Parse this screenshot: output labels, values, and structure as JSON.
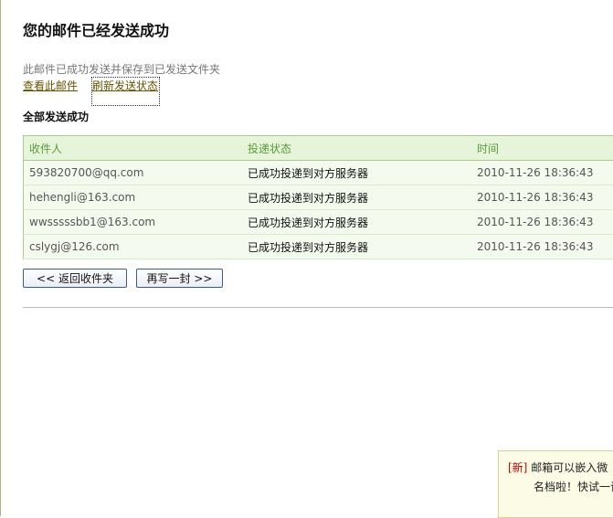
{
  "header": {
    "title": "您的邮件已经发送成功",
    "subtitle": "此邮件已成功发送并保存到已发送文件夹"
  },
  "links": {
    "view_mail": "查看此邮件",
    "refresh_status": "刷新发送状态"
  },
  "section_label": "全部发送成功",
  "table": {
    "columns": [
      "收件人",
      "投递状态",
      "时间"
    ],
    "rows": [
      {
        "recipient": "593820700@qq.com",
        "status": "已成功投递到对方服务器",
        "time": "2010-11-26 18:36:43"
      },
      {
        "recipient": "hehengli@163.com",
        "status": "已成功投递到对方服务器",
        "time": "2010-11-26 18:36:43"
      },
      {
        "recipient": "wwsssssbb1@163.com",
        "status": "已成功投递到对方服务器",
        "time": "2010-11-26 18:36:43"
      },
      {
        "recipient": "cslygj@126.com",
        "status": "已成功投递到对方服务器",
        "time": "2010-11-26 18:36:43"
      }
    ]
  },
  "buttons": {
    "back_to_inbox": "<< 返回收件夹",
    "compose_another": "再写一封 >>"
  },
  "promo": {
    "badge": "[新]",
    "line1": "邮箱可以嵌入微",
    "line2": "名档啦！快试一试"
  },
  "colors": {
    "table_header_bg": "#e6f5d9",
    "table_header_text": "#5a9a3a",
    "table_border": "#a9cc8c",
    "link": "#665500",
    "promo_badge": "#c00000"
  }
}
